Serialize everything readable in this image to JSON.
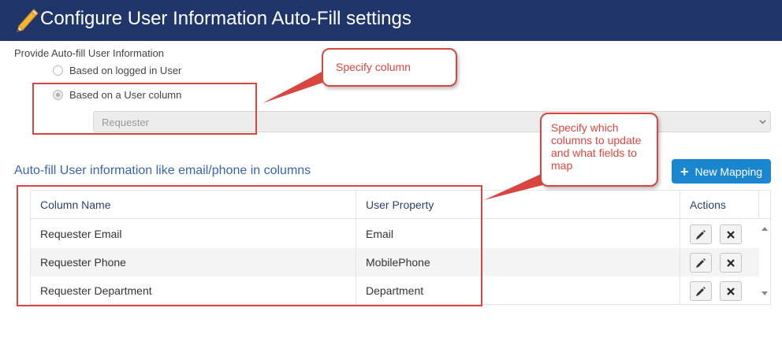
{
  "header": {
    "title": "Configure User Information Auto-Fill settings",
    "icon": "pencil-icon",
    "background": "#20366b"
  },
  "autofill_source": {
    "label": "Provide Auto-fill User Information",
    "options": [
      {
        "label": "Based on logged in User",
        "selected": false
      },
      {
        "label": "Based on a User column",
        "selected": true
      }
    ],
    "user_column_select": {
      "value": "Requester",
      "disabled": true
    }
  },
  "mapping_section": {
    "heading": "Auto-fill User information like email/phone in columns",
    "new_mapping_label": "New Mapping",
    "columns": [
      "Column Name",
      "User Property",
      "Actions"
    ],
    "rows": [
      {
        "column_name": "Requester Email",
        "user_property": "Email"
      },
      {
        "column_name": "Requester Phone",
        "user_property": "MobilePhone"
      },
      {
        "column_name": "Requester Department",
        "user_property": "Department"
      }
    ]
  },
  "annotations": {
    "callout_1": "Specify column",
    "callout_2": "Specify which columns to update and what fields to map",
    "color": "#d9463f"
  },
  "colors": {
    "accent": "#1a86cf",
    "heading": "#3a64ac"
  }
}
